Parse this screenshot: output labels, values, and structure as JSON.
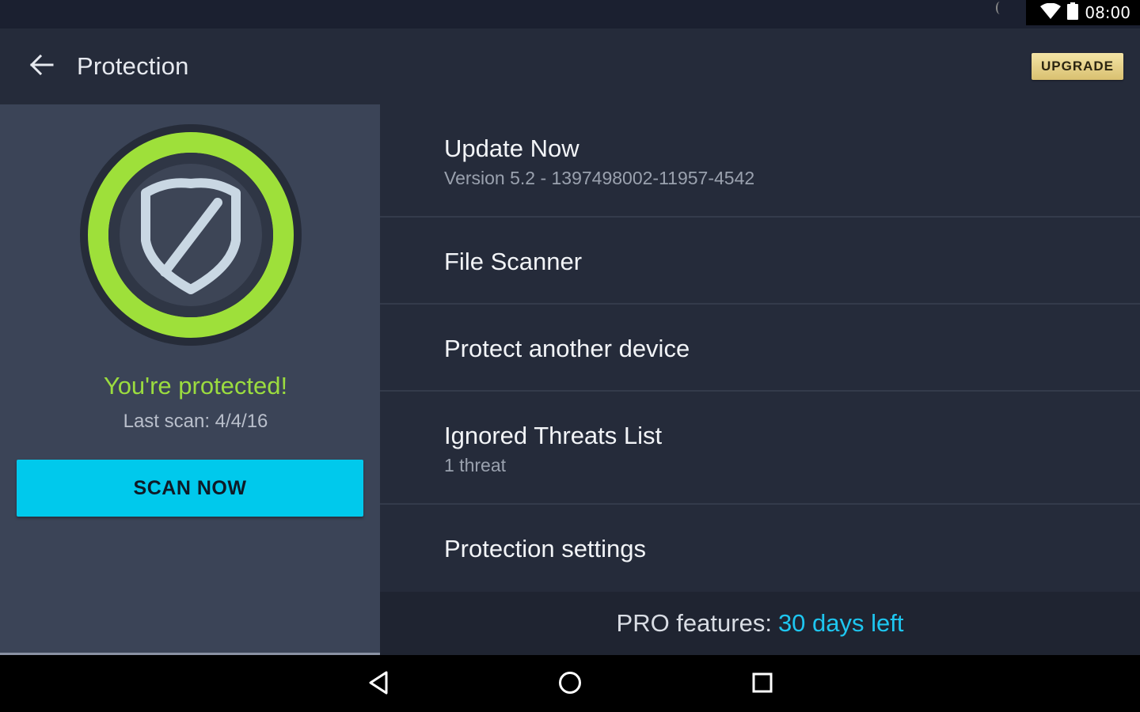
{
  "status_bar": {
    "time": "08:00",
    "icons": [
      "wifi-icon",
      "battery-icon"
    ]
  },
  "app_bar": {
    "title": "Protection",
    "back_icon": "arrow-left-icon",
    "upgrade_label": "UPGRADE"
  },
  "status_panel": {
    "shield_icon": "shield-check-icon",
    "protected_text": "You're protected!",
    "last_scan": "Last scan: 4/4/16",
    "scan_button_label": "SCAN NOW",
    "colors": {
      "ring": "#9ee03a",
      "status_text": "#9bdc3f",
      "scan_button": "#00c9ec"
    }
  },
  "menu": {
    "items": [
      {
        "title": "Update Now",
        "subtitle": "Version 5.2 - 1397498002-11957-4542"
      },
      {
        "title": "File Scanner",
        "subtitle": ""
      },
      {
        "title": "Protect another device",
        "subtitle": ""
      },
      {
        "title": "Ignored Threats List",
        "subtitle": "1 threat"
      },
      {
        "title": "Protection settings",
        "subtitle": ""
      }
    ]
  },
  "pro_bar": {
    "label": "PRO features:",
    "days_left": "30 days left",
    "accent": "#1ec6f0"
  },
  "nav_bar": {
    "icons": [
      "back-triangle-icon",
      "home-circle-icon",
      "recents-square-icon"
    ]
  }
}
